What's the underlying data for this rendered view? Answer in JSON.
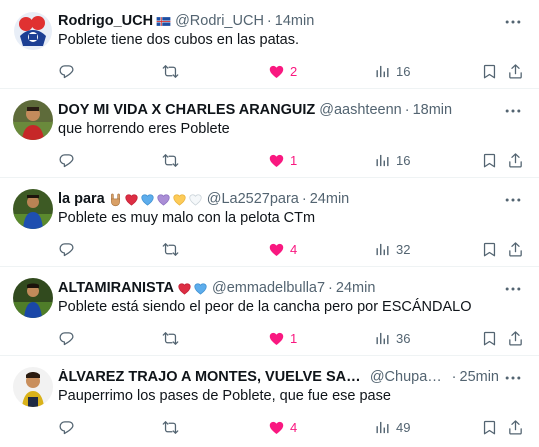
{
  "tweets": [
    {
      "display_name": "Rodrigo_UCH",
      "name_emojis": [
        "flag-icon"
      ],
      "handle": "@Rodri_UCH",
      "time": "14min",
      "text": "Poblete tiene dos cubos en las patas.",
      "replies": "",
      "retweets": "",
      "likes": "2",
      "liked": true,
      "views": "16"
    },
    {
      "display_name": "DOY MI VIDA X CHARLES ARANGUIZ",
      "name_emojis": [],
      "handle": "@aashteenn",
      "time": "18min",
      "text": "que horrendo eres Poblete",
      "replies": "",
      "retweets": "",
      "likes": "1",
      "liked": true,
      "views": "16"
    },
    {
      "display_name": "la para",
      "name_emojis": [
        "rock-hand-icon",
        "red-heart-icon",
        "blue-heart-icon",
        "purple-heart-icon",
        "yellow-heart-icon",
        "white-heart-icon"
      ],
      "handle": "@La2527para",
      "time": "24min",
      "text": "Poblete es muy malo con la pelota CTm",
      "replies": "",
      "retweets": "",
      "likes": "4",
      "liked": true,
      "views": "32"
    },
    {
      "display_name": "ALTAMIRANISTA",
      "name_emojis": [
        "red-heart-icon",
        "blue-heart-icon"
      ],
      "handle": "@emmadelbulla7",
      "time": "24min",
      "text": "Poblete está siendo el peor de la cancha pero por ESCÁNDALO",
      "replies": "",
      "retweets": "",
      "likes": "1",
      "liked": true,
      "views": "36"
    },
    {
      "display_name": "ÁLVAREZ TRAJO A MONTES, VUELVE SAMPA...",
      "name_emojis": [],
      "handle": "@Chupaya...",
      "time": "25min",
      "text": "Pauperrimo los pases de Poblete, que fue ese pase",
      "replies": "",
      "retweets": "",
      "likes": "4",
      "liked": true,
      "views": "49"
    }
  ],
  "colors": {
    "text": "#0f1419",
    "secondary": "#536471",
    "like": "#f91880",
    "divider": "#eff3f4"
  },
  "icons": {
    "reply": "reply-icon",
    "retweet": "retweet-icon",
    "like": "heart-icon",
    "views": "views-icon",
    "bookmark": "bookmark-icon",
    "share": "share-icon",
    "more": "more-icon"
  }
}
